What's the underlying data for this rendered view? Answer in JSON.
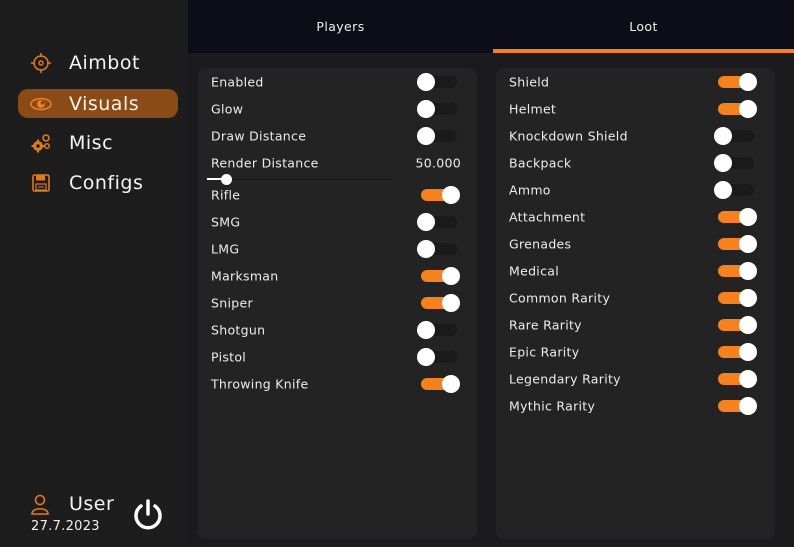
{
  "colors": {
    "accent": "#f5821f",
    "active_nav": "#8a4b16",
    "sidebar_bg": "#1e1d1e",
    "tabbar_bg": "#0c0d16",
    "panel_bg": "#232323"
  },
  "sidebar": {
    "items": [
      {
        "label": "Aimbot",
        "icon": "crosshair-icon",
        "active": false
      },
      {
        "label": "Visuals",
        "icon": "eye-icon",
        "active": true
      },
      {
        "label": "Misc",
        "icon": "gears-icon",
        "active": false
      },
      {
        "label": "Configs",
        "icon": "floppy-disk-icon",
        "active": false
      }
    ],
    "user": {
      "name": "User",
      "date": "27.7.2023",
      "icon": "user-icon",
      "power_icon": "power-icon"
    }
  },
  "tabs": [
    {
      "label": "Players",
      "active": false
    },
    {
      "label": "Loot",
      "active": true
    }
  ],
  "players_panel": {
    "toggles_top": [
      {
        "label": "Enabled",
        "on": false
      },
      {
        "label": "Glow",
        "on": false
      },
      {
        "label": "Draw Distance",
        "on": false
      }
    ],
    "render_distance": {
      "label": "Render Distance",
      "value_text": "50.000",
      "fraction": 0.08
    },
    "weapons": [
      {
        "label": "Rifle",
        "on": true
      },
      {
        "label": "SMG",
        "on": false
      },
      {
        "label": "LMG",
        "on": false
      },
      {
        "label": "Marksman",
        "on": true
      },
      {
        "label": "Sniper",
        "on": true
      },
      {
        "label": "Shotgun",
        "on": false
      },
      {
        "label": "Pistol",
        "on": false
      },
      {
        "label": "Throwing Knife",
        "on": true
      }
    ]
  },
  "loot_panel": {
    "items": [
      {
        "label": "Shield",
        "on": true
      },
      {
        "label": "Helmet",
        "on": true
      },
      {
        "label": "Knockdown Shield",
        "on": false
      },
      {
        "label": "Backpack",
        "on": false
      },
      {
        "label": "Ammo",
        "on": false
      },
      {
        "label": "Attachment",
        "on": true
      },
      {
        "label": "Grenades",
        "on": true
      },
      {
        "label": "Medical",
        "on": true
      },
      {
        "label": "Common Rarity",
        "on": true
      },
      {
        "label": "Rare Rarity",
        "on": true
      },
      {
        "label": "Epic Rarity",
        "on": true
      },
      {
        "label": "Legendary Rarity",
        "on": true
      },
      {
        "label": "Mythic Rarity",
        "on": true
      }
    ]
  }
}
